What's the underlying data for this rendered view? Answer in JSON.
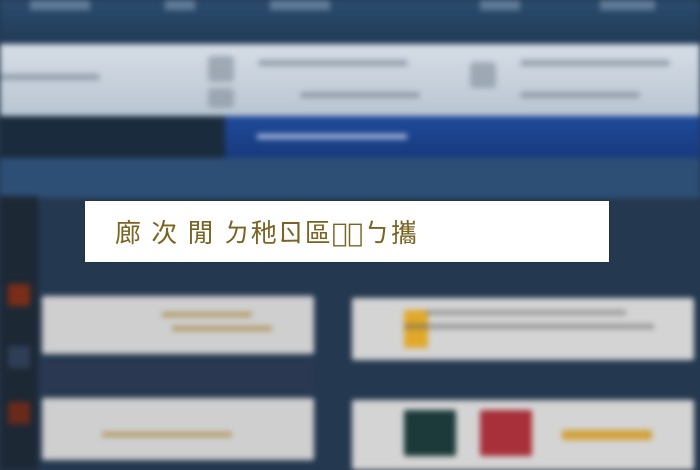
{
  "overlay": {
    "message": "廊 次 閒 ㄉ䄬ㄖ區ㄉ᷀ㄅ攜"
  },
  "colors": {
    "title_bar": "#2b4c6f",
    "toolbar": "#c8d2dd",
    "banner": "#1f4a9a",
    "overlay_bg": "#ffffff",
    "overlay_text": "#7b6422"
  }
}
